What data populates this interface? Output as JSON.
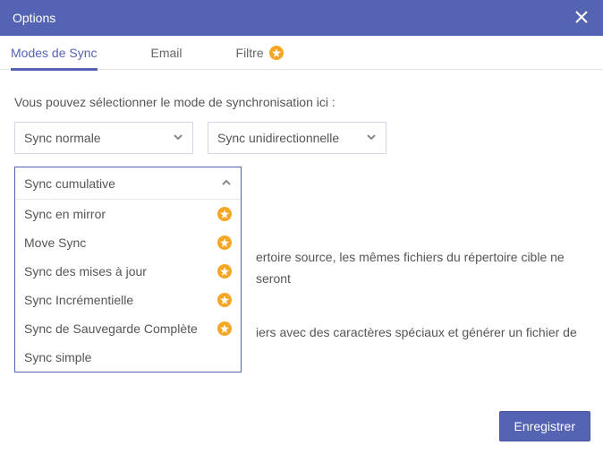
{
  "header": {
    "title": "Options"
  },
  "tabs": [
    {
      "label": "Modes de Sync",
      "badge": false
    },
    {
      "label": "Email",
      "badge": false
    },
    {
      "label": "Filtre",
      "badge": true
    }
  ],
  "instruction": "Vous pouvez sélectionner le mode de synchronisation ici :",
  "select_left": {
    "value": "Sync normale"
  },
  "select_right": {
    "value": "Sync unidirectionnelle"
  },
  "dropdown": {
    "selected": "Sync cumulative",
    "items": [
      {
        "label": "Sync en mirror",
        "badge": true
      },
      {
        "label": "Move Sync",
        "badge": true
      },
      {
        "label": "Sync des mises à jour",
        "badge": true
      },
      {
        "label": "Sync Incrémentielle",
        "badge": true
      },
      {
        "label": "Sync de Sauvegarde Complète",
        "badge": true
      },
      {
        "label": "Sync simple",
        "badge": false
      }
    ]
  },
  "body_text_1": "ertoire source, les mêmes fichiers du répertoire cible ne seront",
  "body_text_2": "iers avec des caractères spéciaux et générer un fichier de",
  "footer": {
    "save_label": "Enregistrer"
  }
}
